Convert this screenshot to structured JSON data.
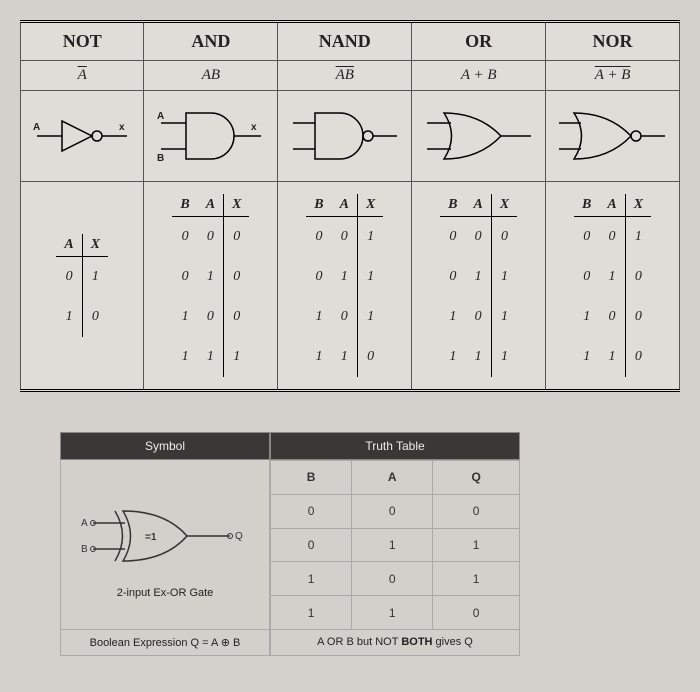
{
  "gates": {
    "not": {
      "name": "NOT",
      "expr_html": "<span class='overline'>A</span>"
    },
    "and": {
      "name": "AND",
      "expr_html": "<span>AB</span>"
    },
    "nand": {
      "name": "NAND",
      "expr_html": "<span class='overline'>AB</span>"
    },
    "or": {
      "name": "OR",
      "expr_html": "<span>A + B</span>"
    },
    "nor": {
      "name": "NOR",
      "expr_html": "<span class='overline'>A + B</span>"
    }
  },
  "truth_tables": {
    "not": {
      "cols": [
        "A",
        "X"
      ],
      "rows": [
        [
          "0",
          "1"
        ],
        [
          "1",
          "0"
        ]
      ]
    },
    "and": {
      "cols": [
        "B",
        "A",
        "X"
      ],
      "rows": [
        [
          "0",
          "0",
          "0"
        ],
        [
          "0",
          "1",
          "0"
        ],
        [
          "1",
          "0",
          "0"
        ],
        [
          "1",
          "1",
          "1"
        ]
      ]
    },
    "nand": {
      "cols": [
        "B",
        "A",
        "X"
      ],
      "rows": [
        [
          "0",
          "0",
          "1"
        ],
        [
          "0",
          "1",
          "1"
        ],
        [
          "1",
          "0",
          "1"
        ],
        [
          "1",
          "1",
          "0"
        ]
      ]
    },
    "or": {
      "cols": [
        "B",
        "A",
        "X"
      ],
      "rows": [
        [
          "0",
          "0",
          "0"
        ],
        [
          "0",
          "1",
          "1"
        ],
        [
          "1",
          "0",
          "1"
        ],
        [
          "1",
          "1",
          "1"
        ]
      ]
    },
    "nor": {
      "cols": [
        "B",
        "A",
        "X"
      ],
      "rows": [
        [
          "0",
          "0",
          "1"
        ],
        [
          "0",
          "1",
          "0"
        ],
        [
          "1",
          "0",
          "0"
        ],
        [
          "1",
          "1",
          "0"
        ]
      ]
    }
  },
  "gate_io": {
    "in1": "A",
    "in2": "B",
    "out": "x"
  },
  "xor": {
    "header_left": "Symbol",
    "header_right": "Truth Table",
    "caption": "2-input Ex-OR Gate",
    "inA": "A",
    "inB": "B",
    "out": "Q",
    "mark": "=1",
    "tt": {
      "cols": [
        "B",
        "A",
        "Q"
      ],
      "rows": [
        [
          "0",
          "0",
          "0"
        ],
        [
          "0",
          "1",
          "1"
        ],
        [
          "1",
          "0",
          "1"
        ],
        [
          "1",
          "1",
          "0"
        ]
      ]
    },
    "expr": "Boolean Expression Q = A ⊕ B",
    "desc_pre": "A OR B but NOT ",
    "desc_bold": "BOTH",
    "desc_post": " gives Q"
  },
  "chart_data": [
    {
      "type": "table",
      "title": "NOT truth table",
      "columns": [
        "A",
        "X"
      ],
      "rows": [
        [
          0,
          1
        ],
        [
          1,
          0
        ]
      ]
    },
    {
      "type": "table",
      "title": "AND truth table",
      "columns": [
        "B",
        "A",
        "X"
      ],
      "rows": [
        [
          0,
          0,
          0
        ],
        [
          0,
          1,
          0
        ],
        [
          1,
          0,
          0
        ],
        [
          1,
          1,
          1
        ]
      ]
    },
    {
      "type": "table",
      "title": "NAND truth table",
      "columns": [
        "B",
        "A",
        "X"
      ],
      "rows": [
        [
          0,
          0,
          1
        ],
        [
          0,
          1,
          1
        ],
        [
          1,
          0,
          1
        ],
        [
          1,
          1,
          0
        ]
      ]
    },
    {
      "type": "table",
      "title": "OR truth table",
      "columns": [
        "B",
        "A",
        "X"
      ],
      "rows": [
        [
          0,
          0,
          0
        ],
        [
          0,
          1,
          1
        ],
        [
          1,
          0,
          1
        ],
        [
          1,
          1,
          1
        ]
      ]
    },
    {
      "type": "table",
      "title": "NOR truth table",
      "columns": [
        "B",
        "A",
        "X"
      ],
      "rows": [
        [
          0,
          0,
          1
        ],
        [
          0,
          1,
          0
        ],
        [
          1,
          0,
          0
        ],
        [
          1,
          1,
          0
        ]
      ]
    },
    {
      "type": "table",
      "title": "XOR truth table",
      "columns": [
        "B",
        "A",
        "Q"
      ],
      "rows": [
        [
          0,
          0,
          0
        ],
        [
          0,
          1,
          1
        ],
        [
          1,
          0,
          1
        ],
        [
          1,
          1,
          0
        ]
      ]
    }
  ]
}
